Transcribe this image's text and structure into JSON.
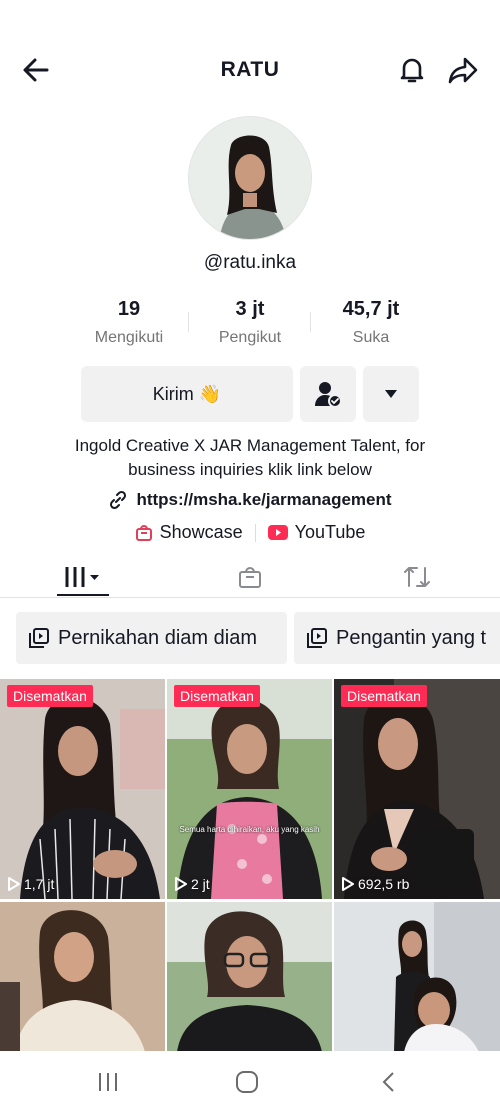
{
  "header": {
    "title": "RATU",
    "back_icon": "arrow-left-icon",
    "bell_icon": "bell-icon",
    "share_icon": "share-arrow-icon"
  },
  "profile": {
    "handle": "@ratu.inka",
    "stats": [
      {
        "value": "19",
        "label": "Mengikuti"
      },
      {
        "value": "3 jt",
        "label": "Pengikut"
      },
      {
        "value": "45,7 jt",
        "label": "Suka"
      }
    ],
    "message_button": "Kirim 👋",
    "bio": "Ingold Creative X JAR Management Talent, for business inquiries klik link below",
    "link": "https://msha.ke/jarmanagement",
    "showcase": "Showcase",
    "youtube": "YouTube"
  },
  "colors": {
    "accent": "#fe2c55",
    "youtube": "#fe2c55",
    "showcase": "#e0405a"
  },
  "playlists": [
    {
      "label": "Pernikahan diam diam"
    },
    {
      "label": "Pengantin yang t"
    }
  ],
  "videos": [
    {
      "pinned": "Disematkan",
      "views": "1,7 jt"
    },
    {
      "pinned": "Disematkan",
      "views": "2 jt",
      "caption": "Semua harta dihiraikan, aku yang kasih"
    },
    {
      "pinned": "Disematkan",
      "views": "692,5 rb"
    },
    {
      "pinned": "",
      "views": ""
    },
    {
      "pinned": "",
      "views": ""
    },
    {
      "pinned": "",
      "views": ""
    }
  ]
}
